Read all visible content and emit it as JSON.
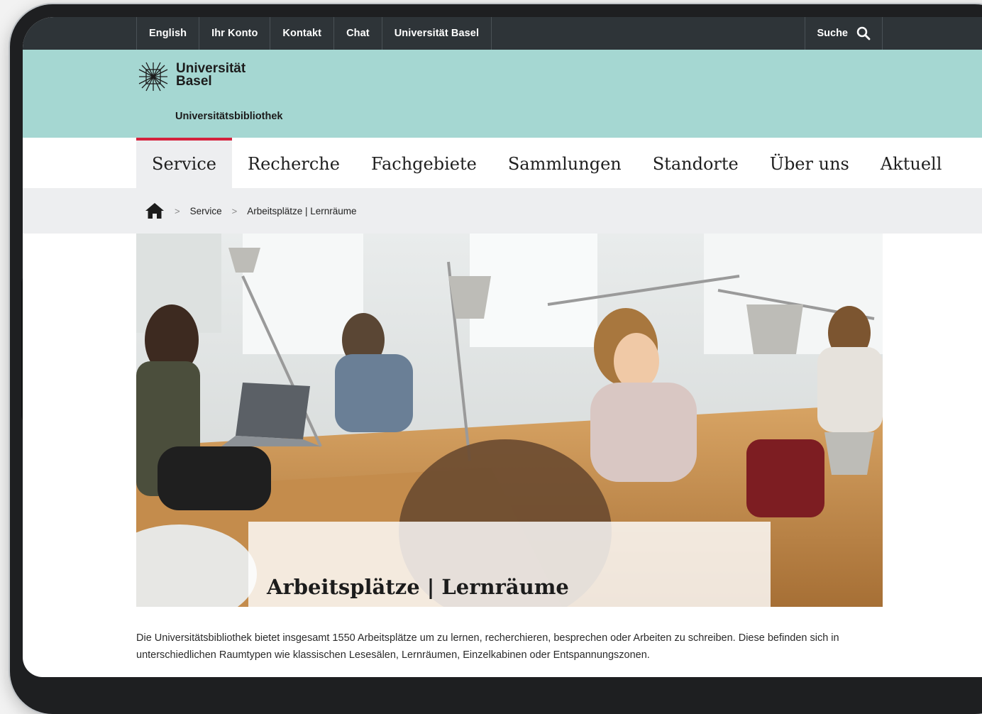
{
  "topbar": {
    "links": [
      "English",
      "Ihr Konto",
      "Kontakt",
      "Chat",
      "Universität Basel"
    ],
    "search_label": "Suche"
  },
  "header": {
    "logo_line1": "Universität",
    "logo_line2": "Basel",
    "subtitle": "Universitätsbibliothek"
  },
  "nav": {
    "items": [
      "Service",
      "Recherche",
      "Fachgebiete",
      "Sammlungen",
      "Standorte",
      "Über uns",
      "Aktuell"
    ],
    "active": "Service"
  },
  "breadcrumb": {
    "items": [
      "Service",
      "Arbeitsplätze | Lernräume"
    ]
  },
  "hero": {
    "title": "Arbeitsplätze | Lernräume"
  },
  "intro": {
    "text": "Die Universitätsbibliothek bietet insgesamt 1550 Arbeitsplätze um zu lernen, recherchieren, besprechen oder Arbeiten zu schreiben. Diese befinden sich in unterschiedlichen Raumtypen wie klassischen Lesesälen, Lernräumen, Einzelkabinen oder Entspannungszonen."
  },
  "colors": {
    "topbar_bg": "#2e3438",
    "header_bg": "#a5d7d2",
    "active_tab_accent": "#d5213d",
    "breadcrumb_bg": "#edeef0"
  },
  "icons": {
    "search": "search-icon",
    "home": "home-icon",
    "logo": "university-logo-icon"
  }
}
